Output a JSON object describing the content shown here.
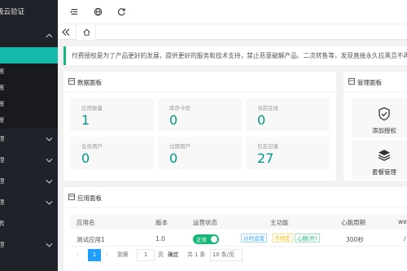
{
  "sidebar": {
    "brand": "极云验证",
    "menu1_chev": "chevron-up-icon",
    "sub_items": [
      "置",
      "置",
      "置",
      "置"
    ],
    "items": [
      {
        "label": "理"
      },
      {
        "label": "理"
      },
      {
        "label": "理"
      },
      {
        "label": "理"
      },
      {
        "label": "表"
      },
      {
        "label": "理"
      }
    ]
  },
  "header": {
    "icons": [
      "menu-fold-icon",
      "globe-icon",
      "refresh-icon"
    ]
  },
  "tabs": {
    "home_icon": "home-icon",
    "prev_icon": "double-chevron-left-icon"
  },
  "notice": {
    "text": "付费授权是为了产品更好的发展，提供更好的服务和技术支持，禁止恶意破解产品、二次转售等，发现直接永久拉黑且不再授"
  },
  "data_panel": {
    "title": "数据面板",
    "stats": [
      {
        "label": "应用数量",
        "value": "1"
      },
      {
        "label": "库存卡密",
        "value": "0"
      },
      {
        "label": "当前在线",
        "value": "0"
      },
      {
        "label": "会员用户",
        "value": "0"
      },
      {
        "label": "过期用户",
        "value": "0"
      },
      {
        "label": "日志记录",
        "value": "27"
      }
    ]
  },
  "manage_panel": {
    "title": "管理面板",
    "items": [
      {
        "label": "添加授权",
        "icon": "shield-check-icon"
      },
      {
        "label": "套餐管理",
        "icon": "layers-icon"
      }
    ]
  },
  "app_panel": {
    "title": "应用面板",
    "columns": [
      "应用名",
      "版本",
      "运营状态",
      "主功能",
      "心跳周期",
      "we"
    ],
    "rows": [
      {
        "name": "测试应用1",
        "version": "1.0",
        "status": "正常",
        "tags": [
          "计时运营",
          "不绑定",
          "心跳(开)"
        ],
        "heartbeat": "300秒",
        "extra": "/"
      }
    ]
  },
  "pager": {
    "current": "1",
    "goto_label": "到第",
    "goto_value": "1",
    "page_label": "页",
    "confirm": "确定",
    "total": "共 1 条",
    "per_page": "10 条/页"
  },
  "colors": {
    "sidebar_bg": "#20222a",
    "active": "#16baaa",
    "stat_value": "#009688",
    "switch_on": "#16b777",
    "pager_current": "#1e9fff"
  }
}
